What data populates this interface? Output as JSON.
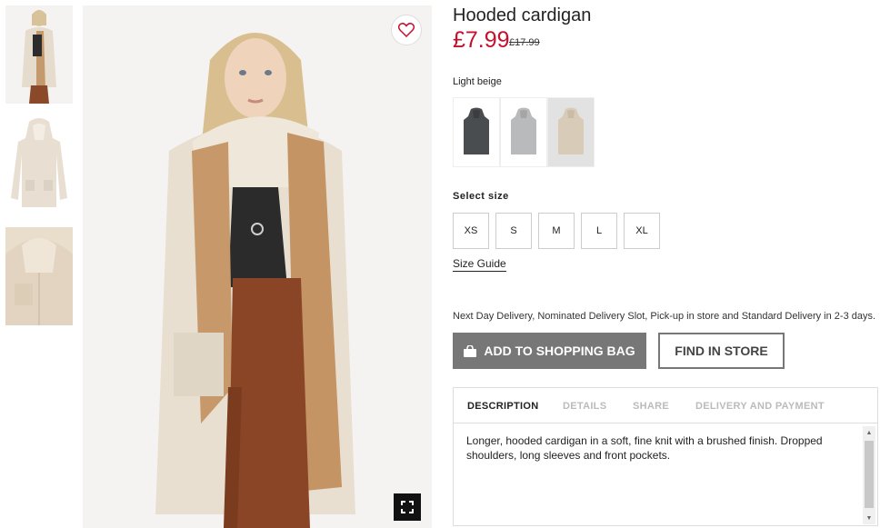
{
  "product": {
    "title": "Hooded cardigan",
    "price": "£7.99",
    "old_price": "£17.99",
    "color_name": "Light beige"
  },
  "colors": [
    {
      "name": "dark-grey",
      "hex": "#4a4d50"
    },
    {
      "name": "light-grey",
      "hex": "#b9babb"
    },
    {
      "name": "light-beige",
      "hex": "#d8cbb8",
      "selected": true
    }
  ],
  "sizes": {
    "label": "Select size",
    "options": [
      "XS",
      "S",
      "M",
      "L",
      "XL"
    ],
    "guide": "Size Guide"
  },
  "delivery_text": "Next Day Delivery, Nominated Delivery Slot, Pick-up in store and Standard Delivery in 2-3 days.",
  "buttons": {
    "add_to_bag": "ADD TO SHOPPING BAG",
    "find_in_store": "FIND IN STORE"
  },
  "tabs": [
    {
      "label": "DESCRIPTION",
      "active": true
    },
    {
      "label": "DETAILS"
    },
    {
      "label": "SHARE"
    },
    {
      "label": "DELIVERY AND PAYMENT"
    }
  ],
  "description": "Longer, hooded cardigan in a soft, fine knit with a brushed finish. Dropped shoulders, long sleeves and front pockets.",
  "icons": {
    "favorite": "heart-icon",
    "zoom": "fullscreen-icon",
    "bag": "shopping-bag-icon"
  },
  "theme": {
    "price_color": "#c8102e",
    "button_bg": "#777777"
  }
}
